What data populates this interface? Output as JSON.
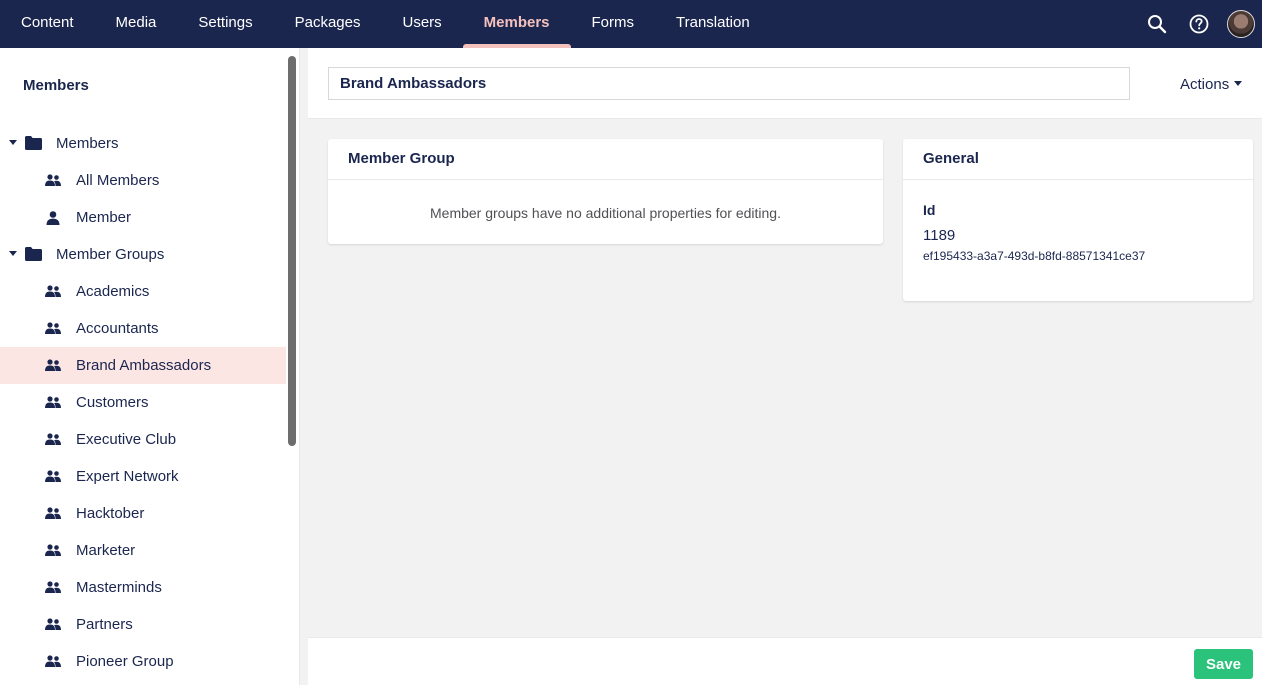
{
  "nav": {
    "items": [
      {
        "label": "Content"
      },
      {
        "label": "Media"
      },
      {
        "label": "Settings"
      },
      {
        "label": "Packages"
      },
      {
        "label": "Users"
      },
      {
        "label": "Members"
      },
      {
        "label": "Forms"
      },
      {
        "label": "Translation"
      }
    ],
    "active": "Members",
    "icons": [
      "search-icon",
      "help-icon",
      "avatar"
    ]
  },
  "sidebar": {
    "title": "Members",
    "tree": [
      {
        "label": "Members",
        "level": 1,
        "icon": "folder-icon",
        "expanded": true
      },
      {
        "label": "All Members",
        "level": 2,
        "icon": "members-icon"
      },
      {
        "label": "Member",
        "level": 2,
        "icon": "member-icon"
      },
      {
        "label": "Member Groups",
        "level": 1,
        "icon": "folder-icon",
        "expanded": true
      },
      {
        "label": "Academics",
        "level": 2,
        "icon": "member-group-icon"
      },
      {
        "label": "Accountants",
        "level": 2,
        "icon": "member-group-icon"
      },
      {
        "label": "Brand Ambassadors",
        "level": 2,
        "icon": "member-group-icon",
        "selected": true
      },
      {
        "label": "Customers",
        "level": 2,
        "icon": "member-group-icon"
      },
      {
        "label": "Executive Club",
        "level": 2,
        "icon": "member-group-icon"
      },
      {
        "label": "Expert Network",
        "level": 2,
        "icon": "member-group-icon"
      },
      {
        "label": "Hacktober",
        "level": 2,
        "icon": "member-group-icon"
      },
      {
        "label": "Marketer",
        "level": 2,
        "icon": "member-group-icon"
      },
      {
        "label": "Masterminds",
        "level": 2,
        "icon": "member-group-icon"
      },
      {
        "label": "Partners",
        "level": 2,
        "icon": "member-group-icon"
      },
      {
        "label": "Pioneer Group",
        "level": 2,
        "icon": "member-group-icon"
      }
    ]
  },
  "header": {
    "name_value": "Brand Ambassadors",
    "actions_label": "Actions"
  },
  "member_group": {
    "title": "Member Group",
    "message": "Member groups have no additional properties for editing."
  },
  "general": {
    "title": "General",
    "id_label": "Id",
    "id_value": "1189",
    "key_value": "ef195433-a3a7-493d-b8fd-88571341ce37"
  },
  "footer": {
    "save_label": "Save"
  },
  "colors": {
    "nav_bg": "#1b264f",
    "accent": "#f5c1bc",
    "selected_bg": "#fce6e4",
    "save_green": "#2bc37c"
  }
}
